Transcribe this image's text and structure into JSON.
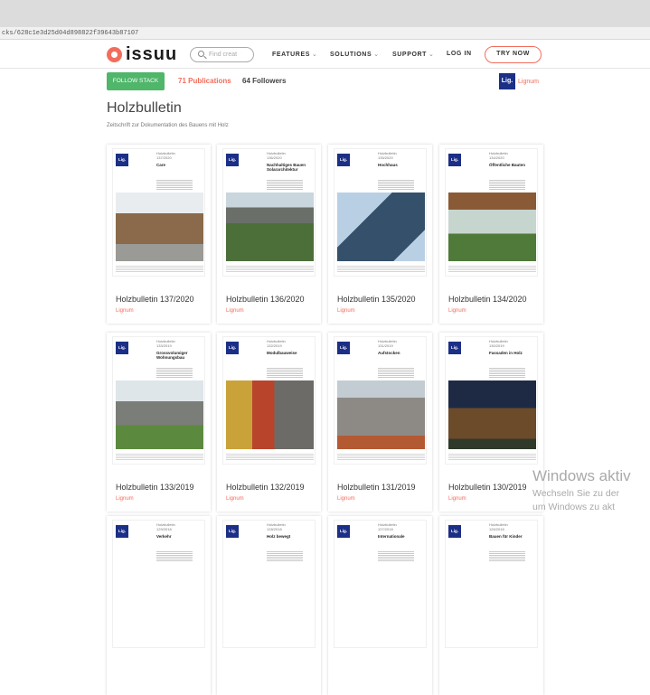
{
  "browser": {
    "url": "cks/628c1e3d25d04d898822f39643b87107"
  },
  "nav": {
    "logo_text": "issuu",
    "search_placeholder": "Find creat",
    "features": "FEATURES",
    "solutions": "SOLUTIONS",
    "support": "SUPPORT",
    "login": "LOG IN",
    "try_now": "TRY NOW",
    "chevron": "⌄"
  },
  "stack": {
    "follow_label": "FOLLOW STACK",
    "publications": "71 Publications",
    "followers": "64 Followers",
    "owner_logo": "Lig.",
    "owner_name": "Lignum",
    "title": "Holzbulletin",
    "subtitle": "Zeitschrift zur Dokumentation des Bauens mit Holz"
  },
  "publications": [
    {
      "title": "Holzbulletin 137/2020",
      "owner": "Lignum",
      "cover_series": "Holzbulletin\n137/2020",
      "cover_title": "Care",
      "cover_logo": "Lig."
    },
    {
      "title": "Holzbulletin 136/2020",
      "owner": "Lignum",
      "cover_series": "Holzbulletin\n136/2020",
      "cover_title": "Nachhaltiges Bauen Solararchitektur",
      "cover_logo": "Lig."
    },
    {
      "title": "Holzbulletin 135/2020",
      "owner": "Lignum",
      "cover_series": "Holzbulletin\n135/2020",
      "cover_title": "Hochhaus",
      "cover_logo": "Lig."
    },
    {
      "title": "Holzbulletin 134/2020",
      "owner": "Lignum",
      "cover_series": "Holzbulletin\n134/2020",
      "cover_title": "Öffentliche Bauten",
      "cover_logo": "Lig."
    },
    {
      "title": "Holzbulletin 133/2019",
      "owner": "Lignum",
      "cover_series": "Holzbulletin\n133/2019",
      "cover_title": "Grossvolumiger Wohnungsbau",
      "cover_logo": "Lig."
    },
    {
      "title": "Holzbulletin 132/2019",
      "owner": "Lignum",
      "cover_series": "Holzbulletin\n132/2019",
      "cover_title": "Modulbauweise",
      "cover_logo": "Lig."
    },
    {
      "title": "Holzbulletin 131/2019",
      "owner": "Lignum",
      "cover_series": "Holzbulletin\n131/2019",
      "cover_title": "Aufstocken",
      "cover_logo": "Lig."
    },
    {
      "title": "Holzbulletin 130/2019",
      "owner": "Lignum",
      "cover_series": "Holzbulletin\n130/2019",
      "cover_title": "Fassaden in Holz",
      "cover_logo": "Lig."
    },
    {
      "title": "",
      "owner": "",
      "cover_series": "Holzbulletin\n129/2018",
      "cover_title": "Verkehr",
      "cover_logo": "Lig."
    },
    {
      "title": "",
      "owner": "",
      "cover_series": "Holzbulletin\n128/2018",
      "cover_title": "Holz bewegt",
      "cover_logo": "Lig."
    },
    {
      "title": "",
      "owner": "",
      "cover_series": "Holzbulletin\n127/2018",
      "cover_title": "Internationale",
      "cover_logo": "Lig."
    },
    {
      "title": "",
      "owner": "",
      "cover_series": "Holzbulletin\n126/2018",
      "cover_title": "Bauen für Kinder",
      "cover_logo": "Lig."
    }
  ],
  "watermark": {
    "line1": "Windows aktiv",
    "line2": "Wechseln Sie zu der",
    "line3": "um Windows zu akt"
  }
}
